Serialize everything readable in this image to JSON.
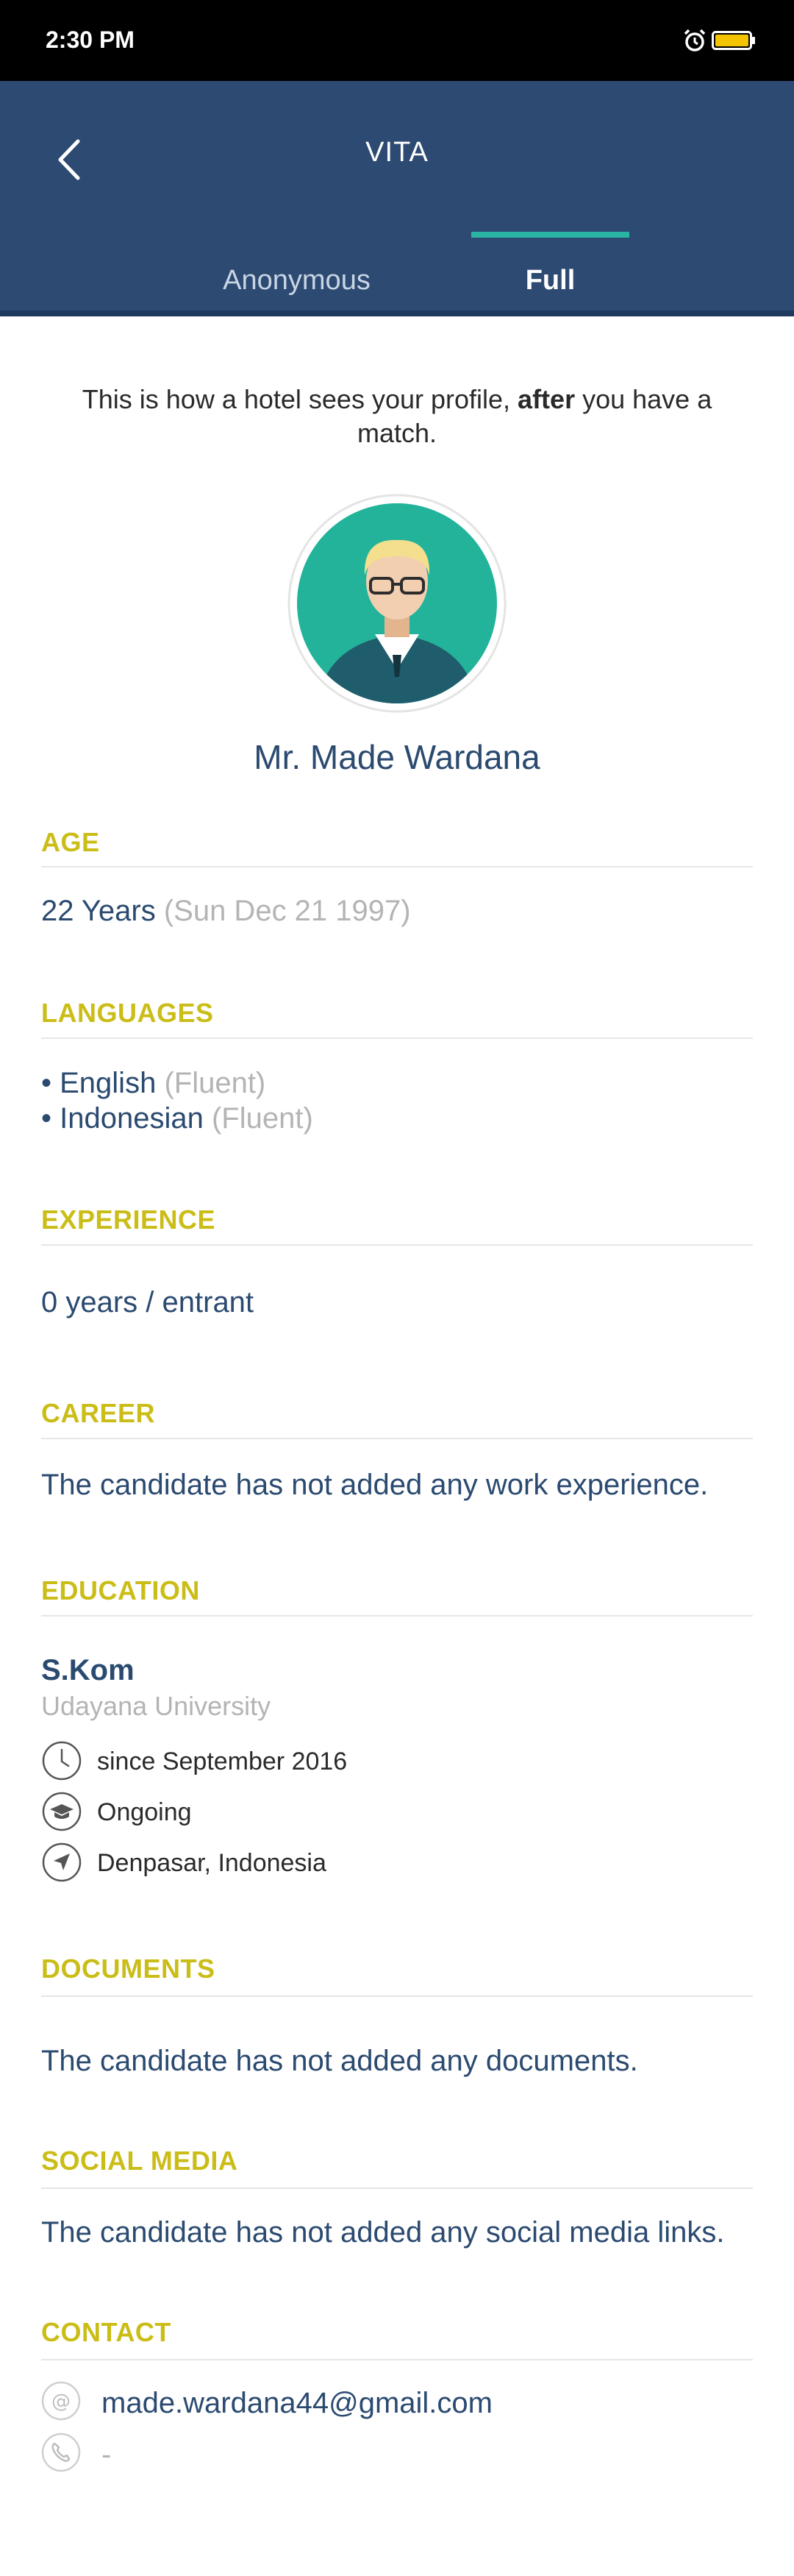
{
  "status_bar": {
    "time": "2:30 PM",
    "icons": [
      "alarm-icon",
      "battery-icon"
    ],
    "battery_color": "#f5c400"
  },
  "header": {
    "title": "VITA",
    "back_icon": "chevron-left-icon",
    "tabs": [
      {
        "label": "Anonymous",
        "active": false
      },
      {
        "label": "Full",
        "active": true
      }
    ],
    "colors": {
      "background": "#2d4a72",
      "tab_indicator": "#2bb3a3"
    }
  },
  "intro": {
    "before": "This is how a hotel sees your profile, ",
    "emphasis": "after",
    "after": " you have a match."
  },
  "profile": {
    "name": "Mr. Made Wardana",
    "avatar_icon": "avatar-icon"
  },
  "sections": {
    "age": {
      "title": "AGE",
      "value": "22 Years",
      "detail": "(Sun Dec 21 1997)"
    },
    "languages": {
      "title": "LANGUAGES",
      "items": [
        {
          "name": "• English",
          "level": "(Fluent)"
        },
        {
          "name": "• Indonesian",
          "level": "(Fluent)"
        }
      ]
    },
    "experience": {
      "title": "EXPERIENCE",
      "value": "0 years / entrant"
    },
    "career": {
      "title": "CAREER",
      "value": "The candidate has not added any work experience."
    },
    "education": {
      "title": "EDUCATION",
      "degree": "S.Kom",
      "school": "Udayana University",
      "since": "since September 2016",
      "status": "Ongoing",
      "location": "Denpasar, Indonesia"
    },
    "documents": {
      "title": "DOCUMENTS",
      "value": "The candidate has not added any documents."
    },
    "social_media": {
      "title": "SOCIAL MEDIA",
      "value": "The candidate has not added any social media links."
    },
    "contact": {
      "title": "CONTACT",
      "email": "made.wardana44@gmail.com",
      "phone": "-"
    }
  },
  "accent_colors": {
    "section_title": "#cbbd17",
    "text": "#2b4a70",
    "muted": "#b4b4b4"
  }
}
